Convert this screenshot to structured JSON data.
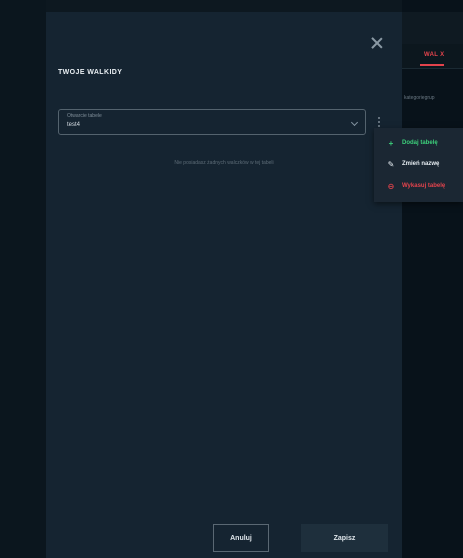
{
  "background": {
    "tab_label": "WAL X",
    "side_text": "kategoriegrup"
  },
  "modal": {
    "title": "TWOJE WALKIDY",
    "select": {
      "label": "Otwarcie tabele",
      "value": "test4"
    },
    "empty_message": "Nie posiadasz żadnych walczków w tej tabeli",
    "buttons": {
      "cancel": "Anuluj",
      "save": "Zapisz"
    }
  },
  "menu": {
    "items": [
      {
        "icon": "plus-icon",
        "label": "Dodaj tabelę",
        "color": "#3ccf7a"
      },
      {
        "icon": "pencil-icon",
        "label": "Zmień nazwę",
        "color": "#e6edf2"
      },
      {
        "icon": "remove-circle-icon",
        "label": "Wykasuj tabelę",
        "color": "#e3434c"
      }
    ]
  },
  "colors": {
    "page_bg": "#0d1820",
    "modal_bg": "#152431",
    "accent_red": "#e3434c",
    "accent_green": "#3ccf7a"
  }
}
